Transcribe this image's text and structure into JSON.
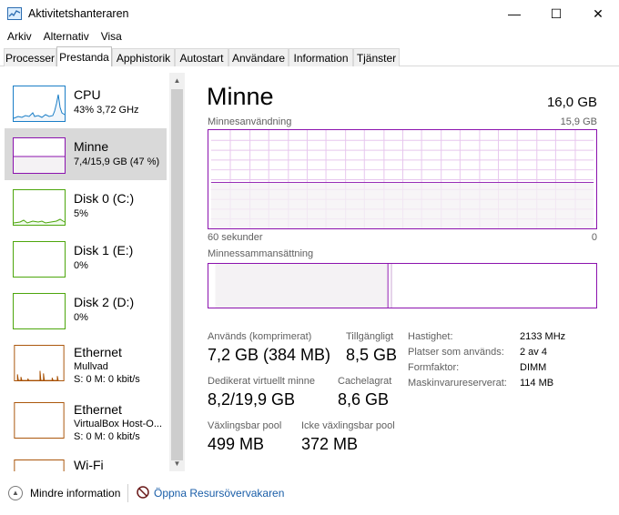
{
  "window": {
    "title": "Aktivitetshanteraren",
    "minimize_glyph": "—",
    "maximize_glyph": "☐",
    "close_glyph": "✕"
  },
  "menu": {
    "items": [
      "Arkiv",
      "Alternativ",
      "Visa"
    ]
  },
  "tabs": [
    "Processer",
    "Prestanda",
    "Apphistorik",
    "Autostart",
    "Användare",
    "Information",
    "Tjänster"
  ],
  "active_tab": "Prestanda",
  "sidebar": {
    "items": [
      {
        "name": "CPU",
        "line1": "43%  3,72 GHz",
        "line2": "",
        "color": "#1a7ec7",
        "fill": "#f1f6fb"
      },
      {
        "name": "Minne",
        "line1": "7,4/15,9 GB (47 %)",
        "line2": "",
        "color": "#8b12ae",
        "fill": "#f4f2f4",
        "selected": true
      },
      {
        "name": "Disk 0 (C:)",
        "line1": "5%",
        "line2": "",
        "color": "#4da60c",
        "fill": "#effaec"
      },
      {
        "name": "Disk 1 (E:)",
        "line1": "0%",
        "line2": "",
        "color": "#4da60c",
        "fill": "#ffffff"
      },
      {
        "name": "Disk 2 (D:)",
        "line1": "0%",
        "line2": "",
        "color": "#4da60c",
        "fill": "#ffffff"
      },
      {
        "name": "Ethernet",
        "line1": "Mullvad",
        "line2": "S: 0  M: 0 kbit/s",
        "color": "#a74f01",
        "fill": "#ffffff"
      },
      {
        "name": "Ethernet",
        "line1": "VirtualBox Host-O...",
        "line2": "S: 0  M: 0 kbit/s",
        "color": "#a74f01",
        "fill": "#ffffff"
      },
      {
        "name": "Wi-Fi",
        "line1": "",
        "line2": "",
        "color": "#a74f01",
        "fill": "#ffffff"
      }
    ]
  },
  "main": {
    "title": "Minne",
    "total": "16,0 GB",
    "usage_label": "Minnesanvändning",
    "usage_max": "15,9 GB",
    "time_left": "60 sekunder",
    "time_right": "0",
    "usage_fraction": 0.47,
    "composition_label": "Minnessammansättning",
    "composition_in_use_fraction": 0.46,
    "accent": "#8b12ae",
    "stats": {
      "in_use_label": "Används (komprimerat)",
      "in_use_value": "7,2 GB (384 MB)",
      "available_label": "Tillgängligt",
      "available_value": "8,5 GB",
      "committed_label": "Dedikerat virtuellt minne",
      "committed_value": "8,2/19,9 GB",
      "cached_label": "Cachelagrat",
      "cached_value": "8,6 GB",
      "paged_label": "Växlingsbar pool",
      "paged_value": "499 MB",
      "nonpaged_label": "Icke växlingsbar pool",
      "nonpaged_value": "372 MB"
    },
    "details": [
      {
        "key": "Hastighet:",
        "value": "2133 MHz"
      },
      {
        "key": "Platser som används:",
        "value": "2 av 4"
      },
      {
        "key": "Formfaktor:",
        "value": "DIMM"
      },
      {
        "key": "Maskinvarureserverat:",
        "value": "114 MB"
      }
    ]
  },
  "footer": {
    "fewer_details": "Mindre information",
    "open_monitor": "Öppna Resursövervakaren"
  }
}
